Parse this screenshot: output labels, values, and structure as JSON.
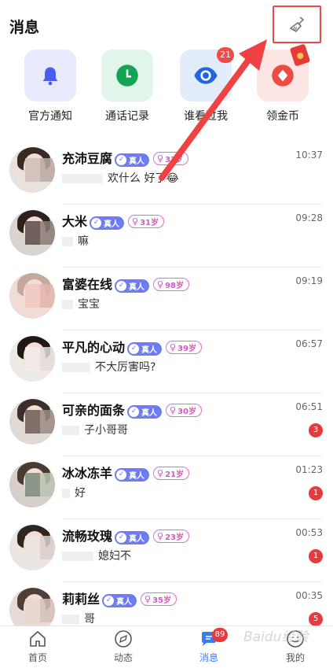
{
  "header": {
    "title": "消息"
  },
  "quick_actions": [
    {
      "label": "官方通知",
      "icon": "bell-icon"
    },
    {
      "label": "通话记录",
      "icon": "clock-icon"
    },
    {
      "label": "谁看过我",
      "icon": "eye-icon",
      "badge": "21"
    },
    {
      "label": "领金币",
      "icon": "coin-icon"
    }
  ],
  "conversations": [
    {
      "name": "充沛豆腐",
      "real_label": "真人",
      "age": "3?岁",
      "time": "10:37",
      "message": "欢什么",
      "message_tail": "好了😂",
      "unread": ""
    },
    {
      "name": "大米",
      "real_label": "真人",
      "age": "31岁",
      "time": "09:28",
      "message": "嘛",
      "message_tail": "",
      "unread": ""
    },
    {
      "name": "富婆在线",
      "real_label": "真人",
      "age": "98岁",
      "time": "09:19",
      "message": "宝宝",
      "message_tail": "",
      "unread": ""
    },
    {
      "name": "平凡的心动",
      "real_label": "真人",
      "age": "39岁",
      "time": "06:57",
      "message": "不大厉害吗?",
      "message_tail": "",
      "unread": ""
    },
    {
      "name": "可亲的面条",
      "real_label": "真人",
      "age": "30岁",
      "time": "06:51",
      "message": "子小哥哥",
      "message_tail": "",
      "unread": "3"
    },
    {
      "name": "冰冰冻羊",
      "real_label": "真人",
      "age": "21岁",
      "time": "01:23",
      "message": "好",
      "message_tail": "",
      "unread": "1"
    },
    {
      "name": "流畅玫瑰",
      "real_label": "真人",
      "age": "23岁",
      "time": "00:53",
      "message": "媳妇不",
      "message_tail": "",
      "unread": "1"
    },
    {
      "name": "莉莉丝",
      "real_label": "真人",
      "age": "35岁",
      "time": "00:35",
      "message": "哥",
      "message_tail": "",
      "unread": "5"
    }
  ],
  "tabs": [
    {
      "label": "首页",
      "icon": "home-icon"
    },
    {
      "label": "动态",
      "icon": "compass-icon"
    },
    {
      "label": "消息",
      "icon": "message-icon",
      "badge": "89",
      "active": true
    },
    {
      "label": "我的",
      "icon": "profile-icon"
    }
  ],
  "watermark": "Baidu经验",
  "colors": {
    "accent": "#3a7bf6",
    "real_badge": "#6e7cf3",
    "age_badge": "#d455c7",
    "unread": "#e83a3a",
    "highlight": "#e74a4a"
  }
}
